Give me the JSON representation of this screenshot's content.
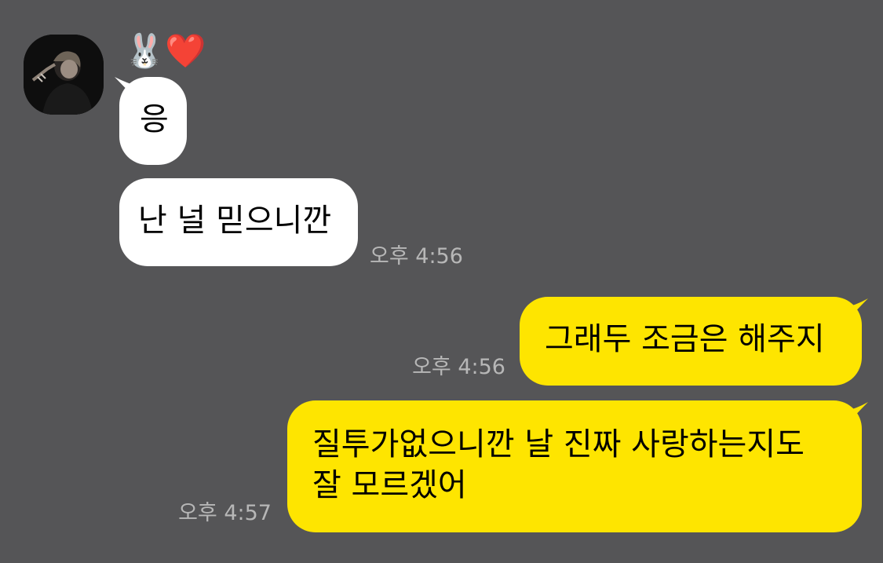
{
  "chat": {
    "sender": {
      "name": "🐰❤️"
    },
    "messages": [
      {
        "side": "in",
        "text": "응"
      },
      {
        "side": "in",
        "text": "난 널 믿으니깐",
        "time": "오후 4:56"
      },
      {
        "side": "out",
        "text": "그래두 조금은 해주지",
        "time": "오후 4:56"
      },
      {
        "side": "out",
        "lines": [
          "질투가없으니깐 날 진짜 사랑하는지도",
          "잘 모르겠어"
        ],
        "time": "오후 4:57"
      }
    ]
  },
  "colors": {
    "background": "#555557",
    "incoming_bubble": "#ffffff",
    "outgoing_bubble": "#fee500",
    "timestamp": "#b7b7b7"
  }
}
